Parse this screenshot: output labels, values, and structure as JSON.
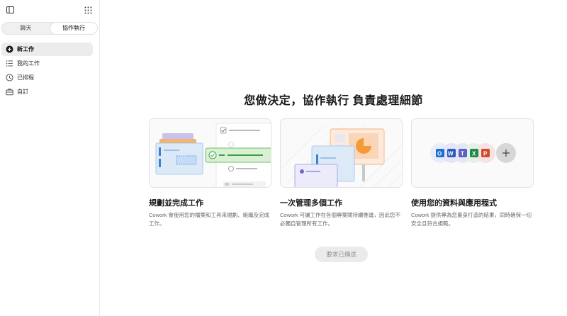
{
  "sidebar": {
    "tabs": [
      {
        "label": "聊天",
        "active": false
      },
      {
        "label": "協作執行",
        "active": true
      }
    ],
    "items": [
      {
        "label": "新工作",
        "icon": "plus-circle-icon",
        "active": true
      },
      {
        "label": "我的工作",
        "icon": "list-icon",
        "active": false
      },
      {
        "label": "已排程",
        "icon": "clock-icon",
        "active": false
      },
      {
        "label": "自訂",
        "icon": "briefcase-icon",
        "active": false
      }
    ]
  },
  "main": {
    "title": "您做決定，協作執行 負責處理細節",
    "features": [
      {
        "title": "規劃並完成工作",
        "description": "Cowork 會使用您的檔案和工具來規劃、組織及完成工作。"
      },
      {
        "title": "一次管理多個工作",
        "description": "Cowork 可讓工作在各個專案間持續推進，因此您不必獨自管理所有工作。"
      },
      {
        "title": "使用您的資料與應用程式",
        "description": "Cowork 提供專為您量身打造的結果，同時確保一切安全且符合規範。"
      }
    ],
    "submit_label": "要求已傳送"
  },
  "colors": {
    "accent_green": "#6fbf73",
    "accent_orange": "#f39a3a",
    "accent_blue": "#3b82d6",
    "active_bg": "#ececec"
  }
}
